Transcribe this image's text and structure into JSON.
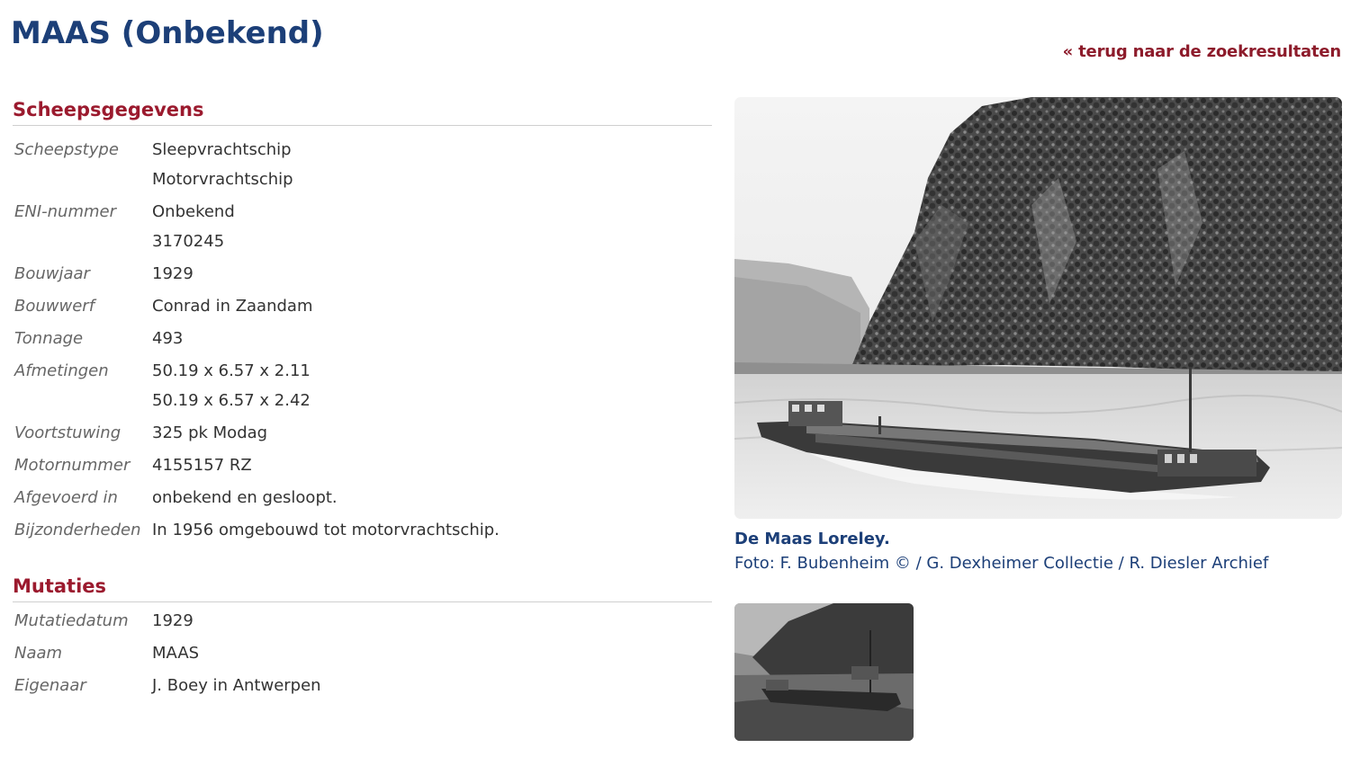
{
  "header": {
    "title": "MAAS (Onbekend)",
    "back_link": "« terug naar de zoekresultaten"
  },
  "ship_data": {
    "heading": "Scheepsgegevens",
    "rows": [
      {
        "label": "Scheepstype",
        "values": [
          "Sleepvrachtschip",
          "Motorvrachtschip"
        ]
      },
      {
        "label": "ENI-nummer",
        "values": [
          "Onbekend",
          "3170245"
        ]
      },
      {
        "label": "Bouwjaar",
        "values": [
          "1929"
        ]
      },
      {
        "label": "Bouwwerf",
        "values": [
          "Conrad in Zaandam"
        ]
      },
      {
        "label": "Tonnage",
        "values": [
          "493"
        ]
      },
      {
        "label": "Afmetingen",
        "values": [
          "50.19 x 6.57 x 2.11",
          "50.19 x 6.57 x 2.42"
        ]
      },
      {
        "label": "Voortstuwing",
        "values": [
          "325 pk Modag"
        ]
      },
      {
        "label": "Motornummer",
        "values": [
          "4155157 RZ"
        ]
      },
      {
        "label": "Afgevoerd in",
        "values": [
          "onbekend en gesloopt."
        ]
      },
      {
        "label": "Bijzonderheden",
        "values": [
          "In 1956 omgebouwd tot motorvrachtschip."
        ]
      }
    ]
  },
  "mutations": {
    "heading": "Mutaties",
    "rows": [
      {
        "label": "Mutatiedatum",
        "values": [
          "1929"
        ]
      },
      {
        "label": "Naam",
        "values": [
          "MAAS"
        ]
      },
      {
        "label": "Eigenaar",
        "values": [
          "J. Boey in Antwerpen"
        ]
      }
    ]
  },
  "photo": {
    "caption_title": "De Maas Loreley.",
    "caption_credit": "Foto: F. Bubenheim © / G. Dexheimer Collectie / R. Diesler Archief"
  },
  "colors": {
    "title": "#1c3f78",
    "heading": "#9b1a2e",
    "link": "#8d1b2b",
    "label": "#666666",
    "value": "#333333"
  }
}
